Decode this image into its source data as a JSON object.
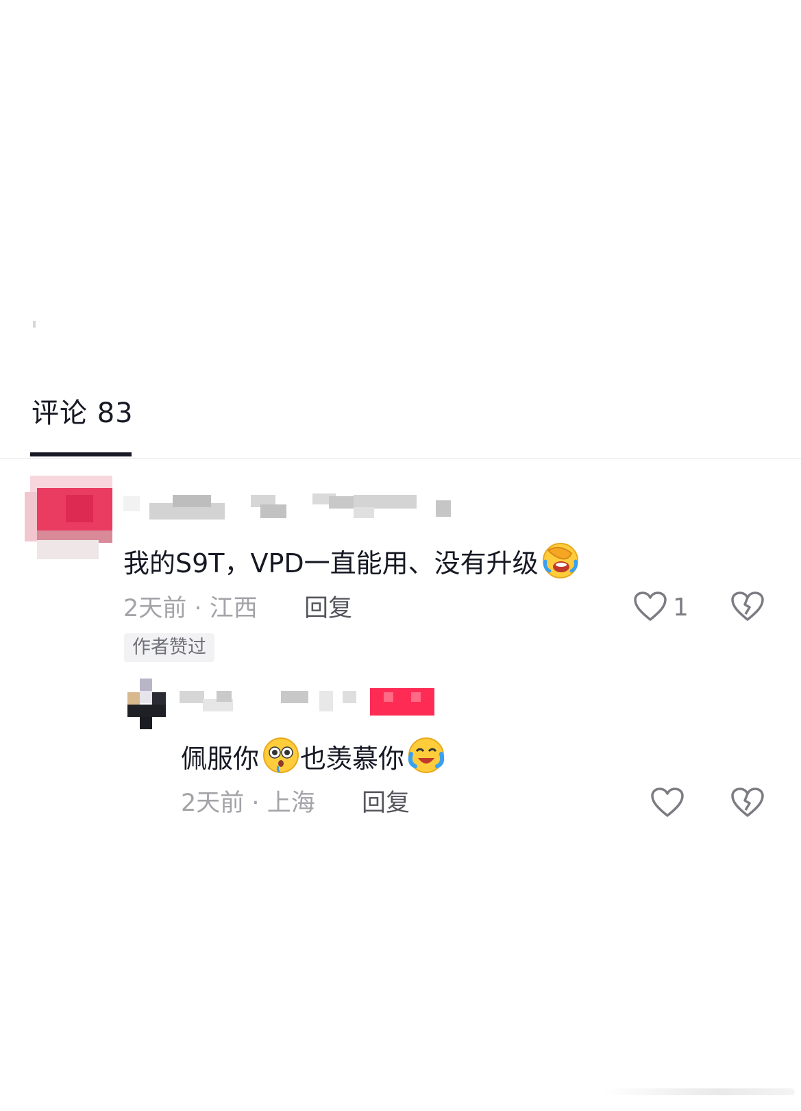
{
  "tabs": {
    "comments_tab_label": "评论 83"
  },
  "comments": [
    {
      "text": "我的S9T，VPD一直能用、没有升级",
      "emoji": "facepalm-crying-emoji",
      "time": "2天前",
      "separator": "·",
      "location": "江西",
      "reply_label": "回复",
      "like_count": "1",
      "author_liked_tag": "作者赞过"
    },
    {
      "text_part1": "佩服你",
      "emoji1": "pleading-emoji",
      "text_part2": "也羡慕你",
      "emoji2": "tears-of-joy-emoji",
      "time": "2天前",
      "separator": "·",
      "location": "上海",
      "reply_label": "回复"
    }
  ],
  "icons": {
    "like": "heart-outline-icon",
    "dislike": "broken-heart-icon"
  },
  "colors": {
    "text_primary": "#161823",
    "text_meta": "#a3a3a8",
    "reply": "#55565c",
    "accent_red": "#fe2c55"
  }
}
